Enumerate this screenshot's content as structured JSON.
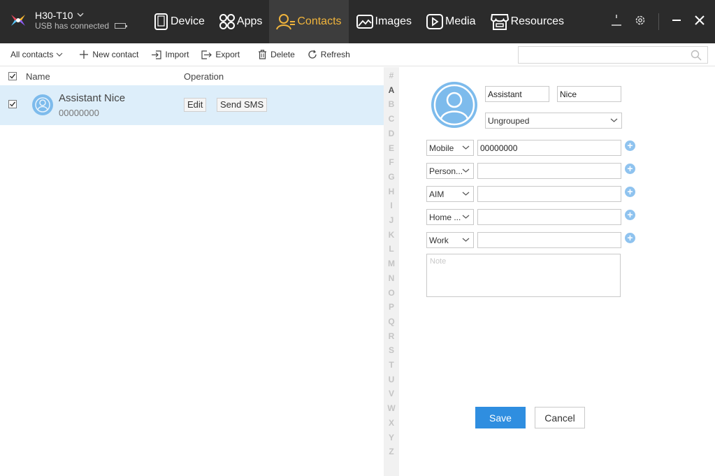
{
  "device": {
    "name": "H30-T10",
    "status": "USB has connected"
  },
  "nav": {
    "items": [
      {
        "label": "Device",
        "icon": "tablet-icon"
      },
      {
        "label": "Apps",
        "icon": "apps-grid-icon"
      },
      {
        "label": "Contacts",
        "icon": "person-icon",
        "active": true
      },
      {
        "label": "Images",
        "icon": "image-icon"
      },
      {
        "label": "Media",
        "icon": "play-icon"
      },
      {
        "label": "Resources",
        "icon": "store-icon"
      }
    ]
  },
  "toolbar": {
    "filter_label": "All contacts",
    "new_label": "New contact",
    "import_label": "Import",
    "export_label": "Export",
    "delete_label": "Delete",
    "refresh_label": "Refresh",
    "search_placeholder": ""
  },
  "list": {
    "header_name": "Name",
    "header_operation": "Operation",
    "rows": [
      {
        "name": "Assistant Nice",
        "phone": "00000000",
        "edit_label": "Edit",
        "sms_label": "Send SMS",
        "checked": true
      }
    ]
  },
  "alphabet": [
    "#",
    "A",
    "B",
    "C",
    "D",
    "E",
    "F",
    "G",
    "H",
    "I",
    "J",
    "K",
    "L",
    "M",
    "N",
    "O",
    "P",
    "Q",
    "R",
    "S",
    "T",
    "U",
    "V",
    "W",
    "X",
    "Y",
    "Z"
  ],
  "editor": {
    "first_name": "Assistant",
    "last_name": "Nice",
    "group": "Ungrouped",
    "fields": [
      {
        "type": "Mobile",
        "value": "00000000"
      },
      {
        "type": "Person...",
        "value": ""
      },
      {
        "type": "AIM",
        "value": ""
      },
      {
        "type": "Home ...",
        "value": ""
      },
      {
        "type": "Work",
        "value": ""
      }
    ],
    "note_placeholder": "Note",
    "save_label": "Save",
    "cancel_label": "Cancel"
  },
  "colors": {
    "topbar_bg": "#2b2b2b",
    "active_nav": "#f0b43c",
    "accent_blue": "#2f8ee0",
    "row_selected": "#ddeefa",
    "avatar": "#7dbbec"
  }
}
